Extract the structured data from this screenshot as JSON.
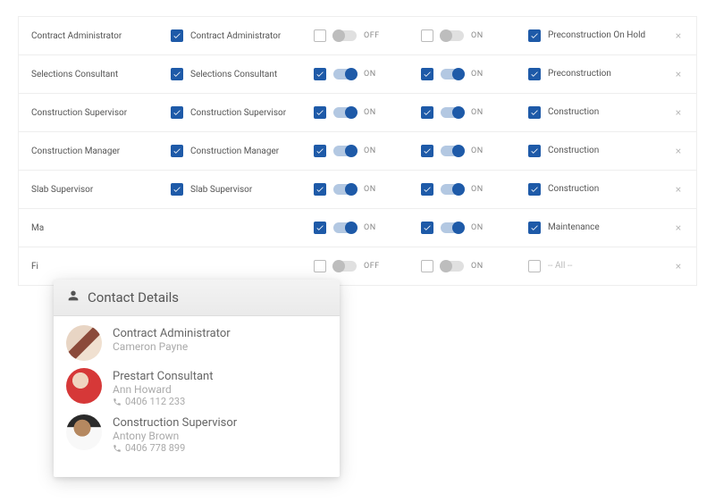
{
  "labels": {
    "on": "ON",
    "off": "OFF"
  },
  "rows": [
    {
      "role": "Contract Administrator",
      "title": "Contract Administrator",
      "titleChecked": true,
      "t1Checked": false,
      "t1On": false,
      "t2Checked": false,
      "t2On": true,
      "stageChecked": true,
      "stage": "Preconstruction On Hold",
      "stageMuted": false
    },
    {
      "role": "Selections Consultant",
      "title": "Selections Consultant",
      "titleChecked": true,
      "t1Checked": true,
      "t1On": true,
      "t2Checked": true,
      "t2On": true,
      "stageChecked": true,
      "stage": "Preconstruction",
      "stageMuted": false
    },
    {
      "role": "Construction Supervisor",
      "title": "Construction Supervisor",
      "titleChecked": true,
      "t1Checked": true,
      "t1On": true,
      "t2Checked": true,
      "t2On": true,
      "stageChecked": true,
      "stage": "Construction",
      "stageMuted": false
    },
    {
      "role": "Construction Manager",
      "title": "Construction Manager",
      "titleChecked": true,
      "t1Checked": true,
      "t1On": true,
      "t2Checked": true,
      "t2On": true,
      "stageChecked": true,
      "stage": "Construction",
      "stageMuted": false
    },
    {
      "role": "Slab Supervisor",
      "title": "Slab Supervisor",
      "titleChecked": true,
      "t1Checked": true,
      "t1On": true,
      "t2Checked": true,
      "t2On": true,
      "stageChecked": true,
      "stage": "Construction",
      "stageMuted": false
    },
    {
      "role": "Ma",
      "title": "",
      "titleChecked": true,
      "t1Checked": true,
      "t1On": true,
      "t2Checked": true,
      "t2On": true,
      "stageChecked": true,
      "stage": "Maintenance",
      "stageMuted": false
    },
    {
      "role": "Fi",
      "title": "",
      "titleChecked": false,
      "t1Checked": false,
      "t1On": false,
      "t2Checked": false,
      "t2On": true,
      "stageChecked": false,
      "stage": "-- All --",
      "stageMuted": true
    }
  ],
  "popup": {
    "title": "Contact Details",
    "contacts": [
      {
        "role": "Contract Administrator",
        "name": "Cameron Payne",
        "phone": ""
      },
      {
        "role": "Prestart Consultant",
        "name": "Ann Howard",
        "phone": "0406 112 233"
      },
      {
        "role": "Construction Supervisor",
        "name": "Antony Brown",
        "phone": "0406 778 899"
      }
    ]
  }
}
